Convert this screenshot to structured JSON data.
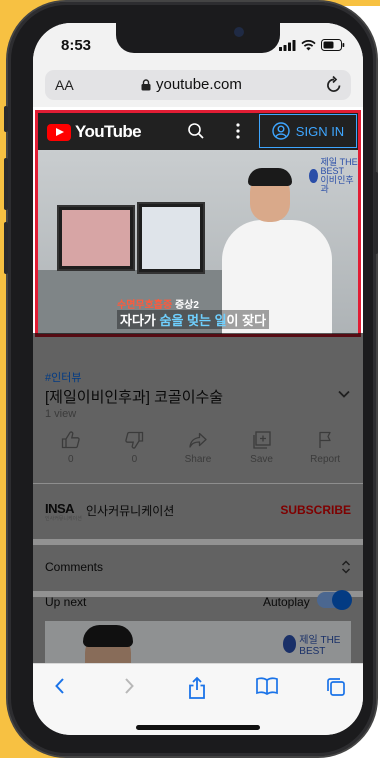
{
  "status": {
    "time": "8:53"
  },
  "browser": {
    "aa_label": "AA",
    "url": "youtube.com"
  },
  "yt": {
    "logo_text": "YouTube",
    "signin_label": "SIGN IN"
  },
  "video": {
    "clinic_badge": "제일 THE BEST",
    "clinic_sub": "이비인후과",
    "caption_line1_a": "수면무호흡증 ",
    "caption_line1_b": "증상2",
    "caption_line2_a": "자다가 ",
    "caption_line2_b": "숨을 멎는 ",
    "caption_line2_c": "일",
    "caption_line2_d": "이 잦다",
    "hashtag": "#인터뷰",
    "title": "[제일이비인후과] 코골이수술",
    "views": "1 view"
  },
  "actions": [
    {
      "label": "0",
      "icon": "thumb-up-icon"
    },
    {
      "label": "0",
      "icon": "thumb-down-icon"
    },
    {
      "label": "Share",
      "icon": "share-icon"
    },
    {
      "label": "Save",
      "icon": "save-icon"
    },
    {
      "label": "Report",
      "icon": "flag-icon"
    }
  ],
  "channel": {
    "logo_text": "INSA",
    "logo_sub": "인사커뮤니케이션",
    "name": "인사커뮤니케이션",
    "subscribe_label": "SUBSCRIBE"
  },
  "comments": {
    "label": "Comments"
  },
  "upnext": {
    "label": "Up next",
    "autoplay_label": "Autoplay",
    "autoplay_on": true,
    "thumb_badge": "제일 THE BEST"
  },
  "colors": {
    "accent_blue": "#3ea6ff",
    "subscribe_red": "#cc0000",
    "highlight_frame": "#e11d34",
    "yellow_bg": "#f7c142"
  }
}
